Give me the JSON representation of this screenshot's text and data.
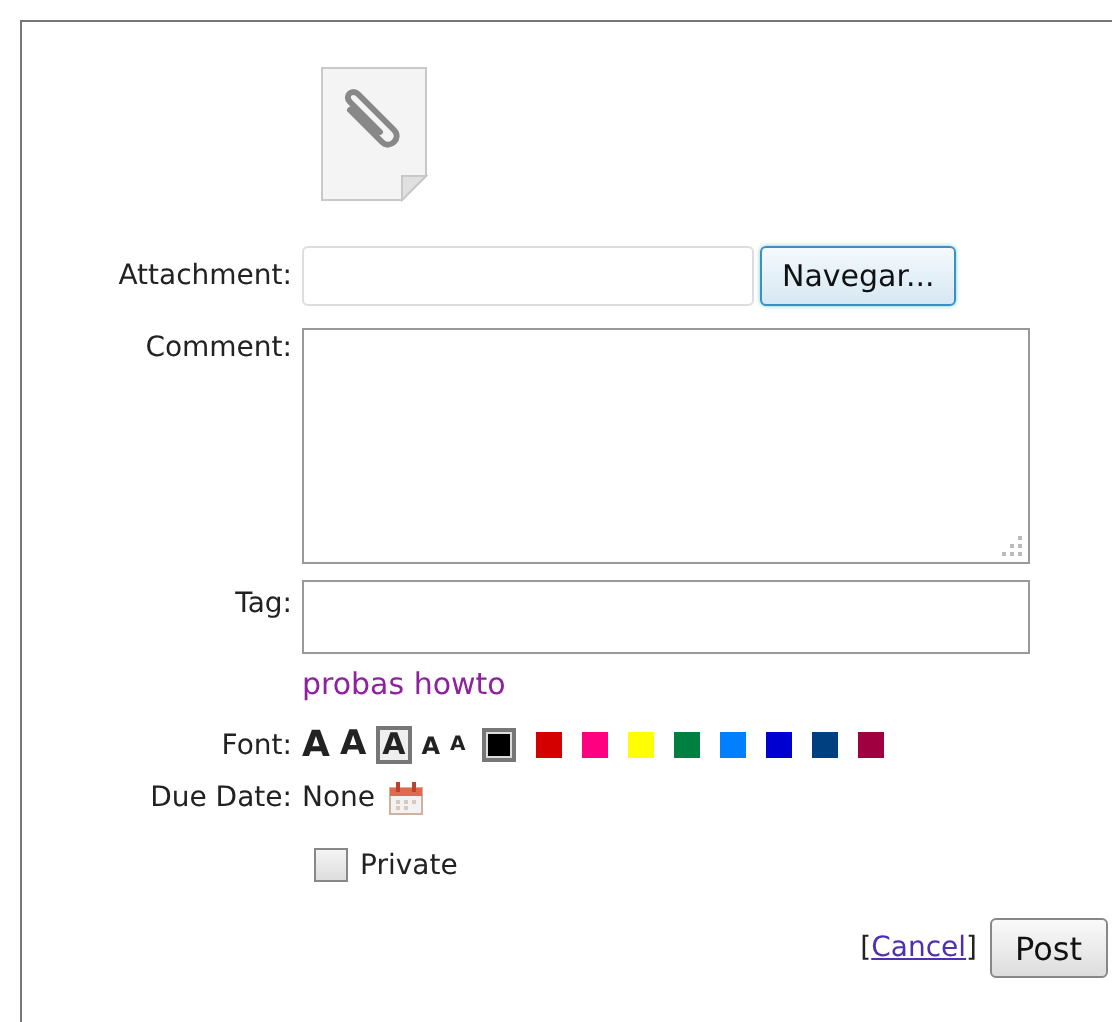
{
  "attachment": {
    "label": "Attachment:",
    "browse_button": "Navegar..."
  },
  "comment": {
    "label": "Comment:"
  },
  "tag": {
    "label": "Tag:",
    "suggestions": [
      "probas howto"
    ]
  },
  "font": {
    "label": "Font:",
    "sizes": [
      {
        "label": "A",
        "selected": false
      },
      {
        "label": "A",
        "selected": false
      },
      {
        "label": "A",
        "selected": true
      },
      {
        "label": "A",
        "selected": false
      },
      {
        "label": "A",
        "selected": false
      }
    ],
    "colors": [
      {
        "color": "#000000",
        "selected": true
      },
      {
        "color": "#d40000",
        "selected": false
      },
      {
        "color": "#ff0080",
        "selected": false
      },
      {
        "color": "#ffff00",
        "selected": false
      },
      {
        "color": "#008040",
        "selected": false
      },
      {
        "color": "#0080ff",
        "selected": false
      },
      {
        "color": "#0000d0",
        "selected": false
      },
      {
        "color": "#004080",
        "selected": false
      },
      {
        "color": "#a00040",
        "selected": false
      }
    ]
  },
  "due_date": {
    "label": "Due Date:",
    "value": "None"
  },
  "private": {
    "label": "Private",
    "checked": false
  },
  "cancel": {
    "open": "[",
    "label": "Cancel",
    "close": "]"
  },
  "post_button": "Post"
}
